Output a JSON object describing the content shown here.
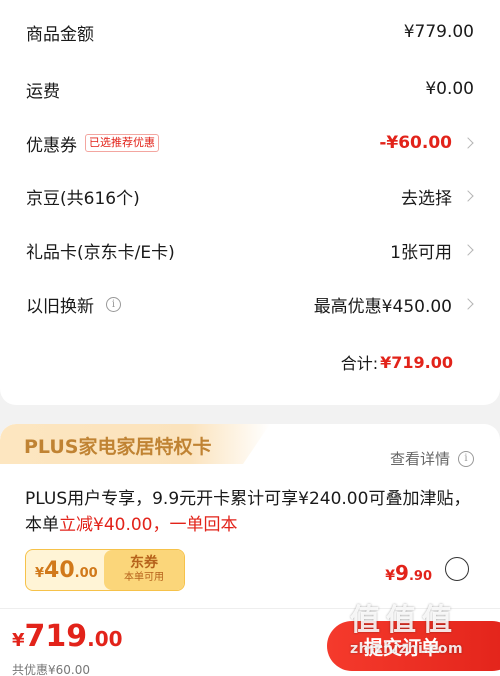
{
  "summary": {
    "goods_amount": {
      "label": "商品金额",
      "value": "¥779.00"
    },
    "shipping": {
      "label": "运费",
      "value": "¥0.00"
    },
    "coupon": {
      "label": "优惠券",
      "tag": "已选推荐优惠",
      "value": "-¥60.00"
    },
    "jingdou": {
      "label": "京豆(共616个)",
      "value": "去选择"
    },
    "gift_card": {
      "label": "礼品卡(京东卡/E卡)",
      "value": "1张可用"
    },
    "trade_in": {
      "label": "以旧换新",
      "value": "最高优惠¥450.00"
    },
    "total": {
      "label": "合计:",
      "value": "¥719.00"
    }
  },
  "plus_card": {
    "title": "PLUS家电家居特权卡",
    "detail_link": "查看详情",
    "desc_main": "PLUS用户专享，9.9元开卡累计可享¥240.00可叠加津贴，本单",
    "desc_highlight": "立减¥40.00，一单回本",
    "coupon": {
      "symbol": "¥",
      "int": "40",
      "dec": ".00",
      "title": "东券",
      "subtitle": "本单可用"
    },
    "price": {
      "symbol": "¥",
      "int": "9",
      "dec": ".90"
    }
  },
  "bottom_bar": {
    "price": {
      "symbol": "¥",
      "int": "719",
      "dec": ".00"
    },
    "discount": "共优惠¥60.00",
    "submit_label": "提交订单"
  },
  "watermark": {
    "logo": "值值值",
    "url": "zhizhizhi.com"
  },
  "colors": {
    "accent_red": "#e2231a",
    "plus_gold": "#c08333",
    "coupon_bg": "#fff4d6"
  }
}
